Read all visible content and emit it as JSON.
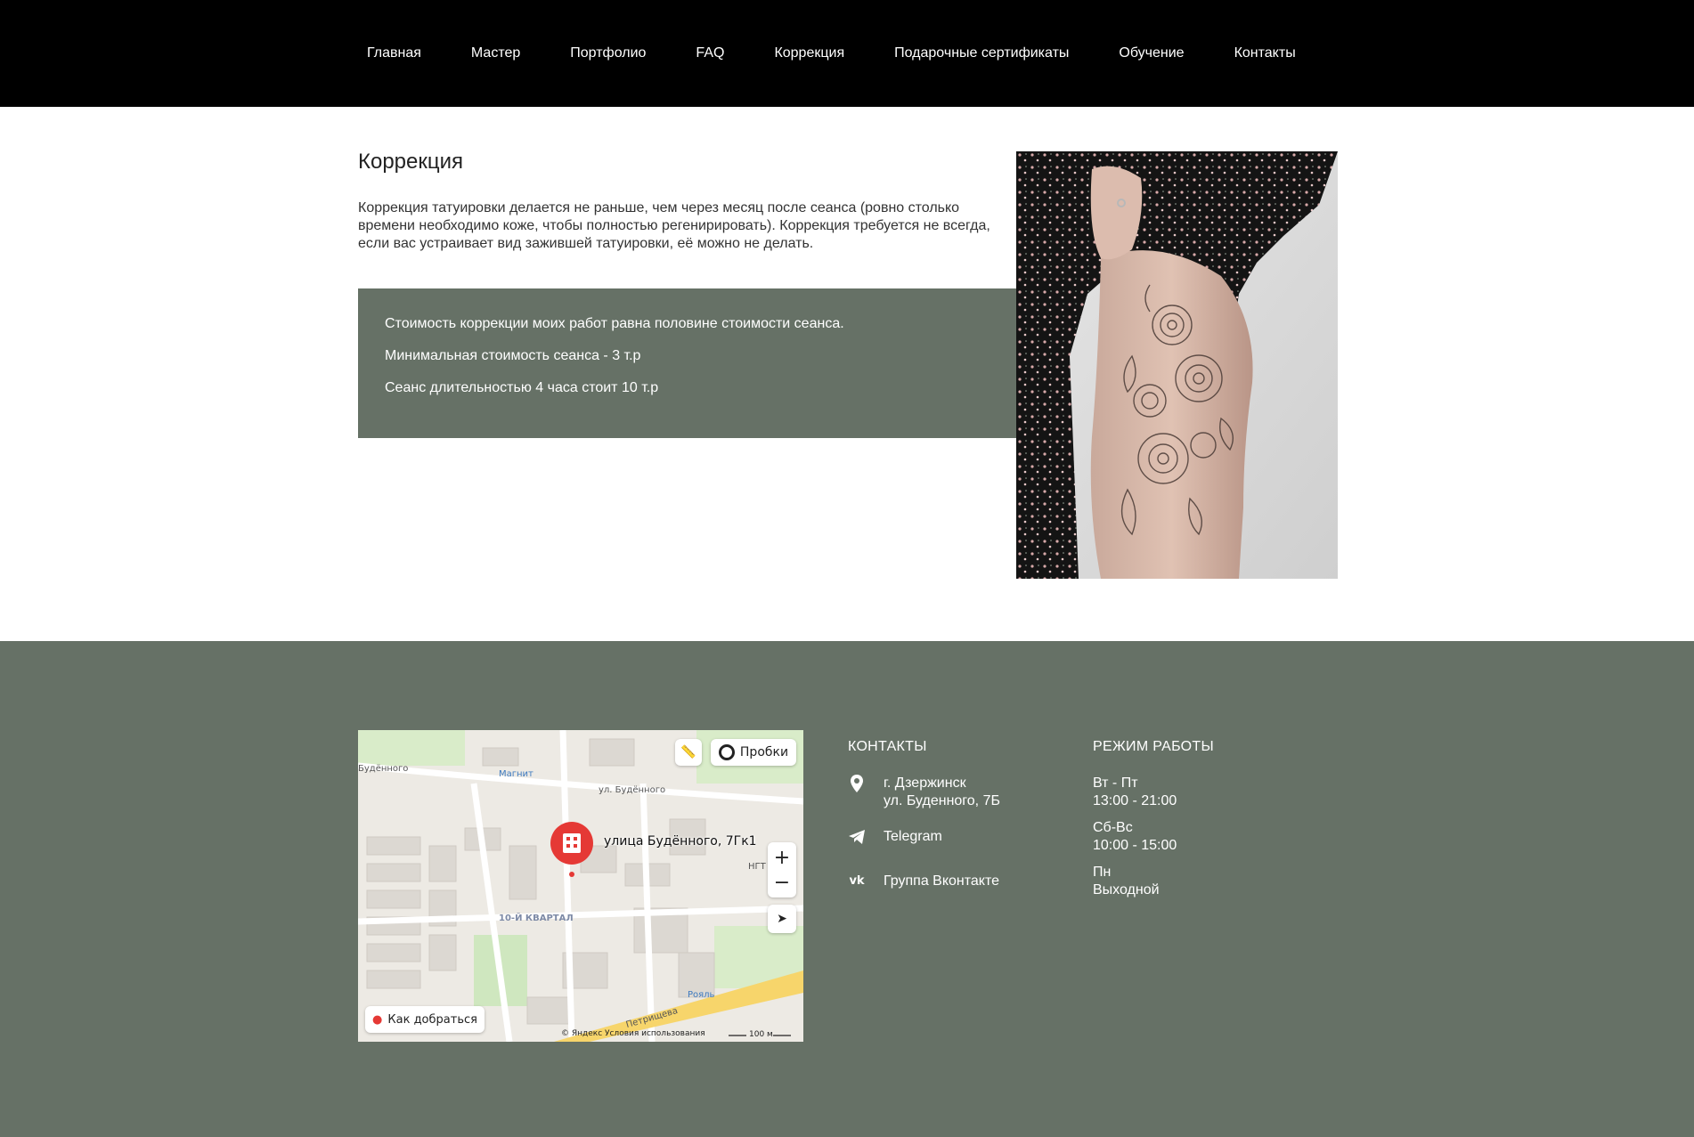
{
  "nav": {
    "items": [
      {
        "label": "Главная"
      },
      {
        "label": "Мастер"
      },
      {
        "label": "Портфолио"
      },
      {
        "label": "FAQ"
      },
      {
        "label": "Коррекция"
      },
      {
        "label": "Подарочные сертификаты"
      },
      {
        "label": "Обучение"
      },
      {
        "label": "Контакты"
      }
    ]
  },
  "main": {
    "title": "Коррекция",
    "text": "Коррекция татуировки делается не раньше, чем через месяц после сеанса (ровно столько времени необходимо коже, чтобы полностью регенирировать). Коррекция требуется не всегда, если вас устраивает вид зажившей татуировки, её можно не делать.",
    "box_lines": [
      "Стоимость коррекции моих работ равна половине стоимости сеанса.",
      "Минимальная стоимость сеанса - 3 т.р",
      "Сеанс длительностью 4 часа стоит 10 т.р"
    ]
  },
  "footer": {
    "contacts_title": "КОНТАКТЫ",
    "address_line1": "г. Дзержинск",
    "address_line2": "ул. Буденного, 7Б",
    "telegram": "Telegram",
    "vk": "Группа Вконтакте",
    "hours_title": "РЕЖИМ РАБОТЫ",
    "hours": [
      {
        "days": "Вт - Пт",
        "time": "13:00 - 21:00"
      },
      {
        "days": "Сб-Вс",
        "time": "10:00 - 15:00"
      },
      {
        "days": "Пн",
        "time": "Выходной"
      }
    ]
  },
  "map": {
    "traffic_label": "Пробки",
    "route_label": "Как добраться",
    "address": "улица Будённого, 7Гк1",
    "copyright": "© Яндекс   Условия использования",
    "scale": "100 м",
    "labels": {
      "street1": "ул. Будённого",
      "street2": "Будённого",
      "district": "10-Й КВАРТАЛ",
      "shop1": "Магнит",
      "shop2": "Рояль",
      "street3": "Петрищева",
      "org": "НГТ"
    }
  },
  "colors": {
    "header_bg": "#000000",
    "accent_green": "#667166",
    "map_pin": "#e53935"
  }
}
